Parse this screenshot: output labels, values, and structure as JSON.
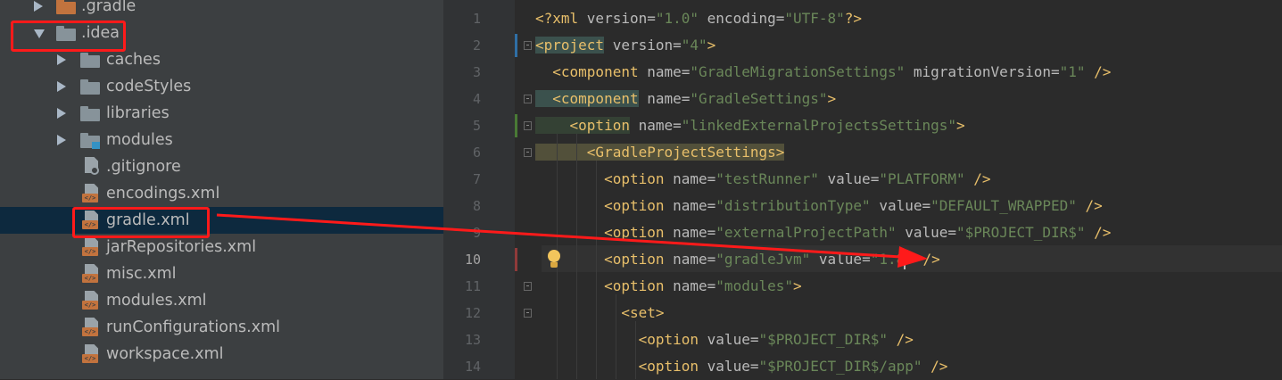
{
  "tree": {
    "items": [
      {
        "label": ".gradle",
        "kind": "folder-orange",
        "expander": "collapsed"
      },
      {
        "label": ".idea",
        "kind": "folder",
        "expander": "expanded"
      },
      {
        "label": "caches",
        "kind": "folder",
        "expander": "collapsed"
      },
      {
        "label": "codeStyles",
        "kind": "folder",
        "expander": "collapsed"
      },
      {
        "label": "libraries",
        "kind": "folder",
        "expander": "collapsed"
      },
      {
        "label": "modules",
        "kind": "folder-module",
        "expander": "collapsed"
      },
      {
        "label": ".gitignore",
        "kind": "gitignore-file"
      },
      {
        "label": "encodings.xml",
        "kind": "xml-file"
      },
      {
        "label": "gradle.xml",
        "kind": "xml-file",
        "selected": true
      },
      {
        "label": "jarRepositories.xml",
        "kind": "xml-file"
      },
      {
        "label": "misc.xml",
        "kind": "xml-file"
      },
      {
        "label": "modules.xml",
        "kind": "xml-file"
      },
      {
        "label": "runConfigurations.xml",
        "kind": "xml-file"
      },
      {
        "label": "workspace.xml",
        "kind": "xml-file"
      }
    ]
  },
  "editor": {
    "current_line": 10,
    "lines": [
      {
        "num": "1",
        "parts": [
          [
            "pi",
            "<?xml "
          ],
          [
            "attr",
            "version="
          ],
          [
            "val",
            "\"1.0\""
          ],
          [
            "attr",
            " encoding="
          ],
          [
            "val",
            "\"UTF-8\""
          ],
          [
            "pi",
            "?>"
          ]
        ]
      },
      {
        "num": "2",
        "parts": [
          [
            "tag",
            "<project"
          ],
          [
            "attr",
            " version="
          ],
          [
            "val",
            "\"4\""
          ],
          [
            "tag",
            ">"
          ]
        ]
      },
      {
        "num": "3",
        "parts": [
          [
            "tag",
            "  <component"
          ],
          [
            "attr",
            " name="
          ],
          [
            "val",
            "\"GradleMigrationSettings\""
          ],
          [
            "attr",
            " migrationVersion="
          ],
          [
            "val",
            "\"1\""
          ],
          [
            "tag",
            " />"
          ]
        ]
      },
      {
        "num": "4",
        "parts": [
          [
            "tag",
            "  <component"
          ],
          [
            "attr",
            " name="
          ],
          [
            "val",
            "\"GradleSettings\""
          ],
          [
            "tag",
            ">"
          ]
        ]
      },
      {
        "num": "5",
        "parts": [
          [
            "tag",
            "    <option"
          ],
          [
            "attr",
            " name="
          ],
          [
            "val",
            "\"linkedExternalProjectsSettings\""
          ],
          [
            "tag",
            ">"
          ]
        ]
      },
      {
        "num": "6",
        "parts": [
          [
            "tag",
            "      <GradleProjectSettings>"
          ]
        ]
      },
      {
        "num": "7",
        "parts": [
          [
            "tag",
            "        <option"
          ],
          [
            "attr",
            " name="
          ],
          [
            "val",
            "\"testRunner\""
          ],
          [
            "attr",
            " value="
          ],
          [
            "val",
            "\"PLATFORM\""
          ],
          [
            "tag",
            " />"
          ]
        ]
      },
      {
        "num": "8",
        "parts": [
          [
            "tag",
            "        <option"
          ],
          [
            "attr",
            " name="
          ],
          [
            "val",
            "\"distributionType\""
          ],
          [
            "attr",
            " value="
          ],
          [
            "val",
            "\"DEFAULT_WRAPPED\""
          ],
          [
            "tag",
            " />"
          ]
        ]
      },
      {
        "num": "9",
        "parts": [
          [
            "tag",
            "        <option"
          ],
          [
            "attr",
            " name="
          ],
          [
            "val",
            "\"externalProjectPath\""
          ],
          [
            "attr",
            " value="
          ],
          [
            "val",
            "\"$PROJECT_DIR$\""
          ],
          [
            "tag",
            " />"
          ]
        ]
      },
      {
        "num": "10",
        "parts": [
          [
            "tag",
            "        <option"
          ],
          [
            "attr",
            " name="
          ],
          [
            "val",
            "\"gradleJvm\""
          ],
          [
            "attr",
            " value="
          ],
          [
            "val",
            "\"1.8"
          ],
          [
            "caret",
            ""
          ],
          [
            "val",
            "\""
          ],
          [
            "tag",
            " />"
          ]
        ]
      },
      {
        "num": "11",
        "parts": [
          [
            "tag",
            "        <option"
          ],
          [
            "attr",
            " name="
          ],
          [
            "val",
            "\"modules\""
          ],
          [
            "tag",
            ">"
          ]
        ]
      },
      {
        "num": "12",
        "parts": [
          [
            "tag",
            "          <set>"
          ]
        ]
      },
      {
        "num": "13",
        "parts": [
          [
            "tag",
            "            <option"
          ],
          [
            "attr",
            " value="
          ],
          [
            "val",
            "\"$PROJECT_DIR$\""
          ],
          [
            "tag",
            " />"
          ]
        ]
      },
      {
        "num": "14",
        "parts": [
          [
            "tag",
            "            <option"
          ],
          [
            "attr",
            " value="
          ],
          [
            "val",
            "\"$PROJECT_DIR$/app\""
          ],
          [
            "tag",
            " />"
          ]
        ]
      }
    ]
  },
  "colors": {
    "tree_bg": "#3c3f41",
    "editor_bg": "#2b2b2b",
    "selection": "#0d293e",
    "annotation_red": "#ff1a1a",
    "xml_tag": "#e8bf6a",
    "xml_value": "#6a8759"
  },
  "icons": {
    "expand": "triangle-right-icon",
    "collapse": "triangle-down-icon",
    "folder": "folder-icon",
    "xml": "xml-file-icon",
    "intention": "lightbulb-icon"
  }
}
